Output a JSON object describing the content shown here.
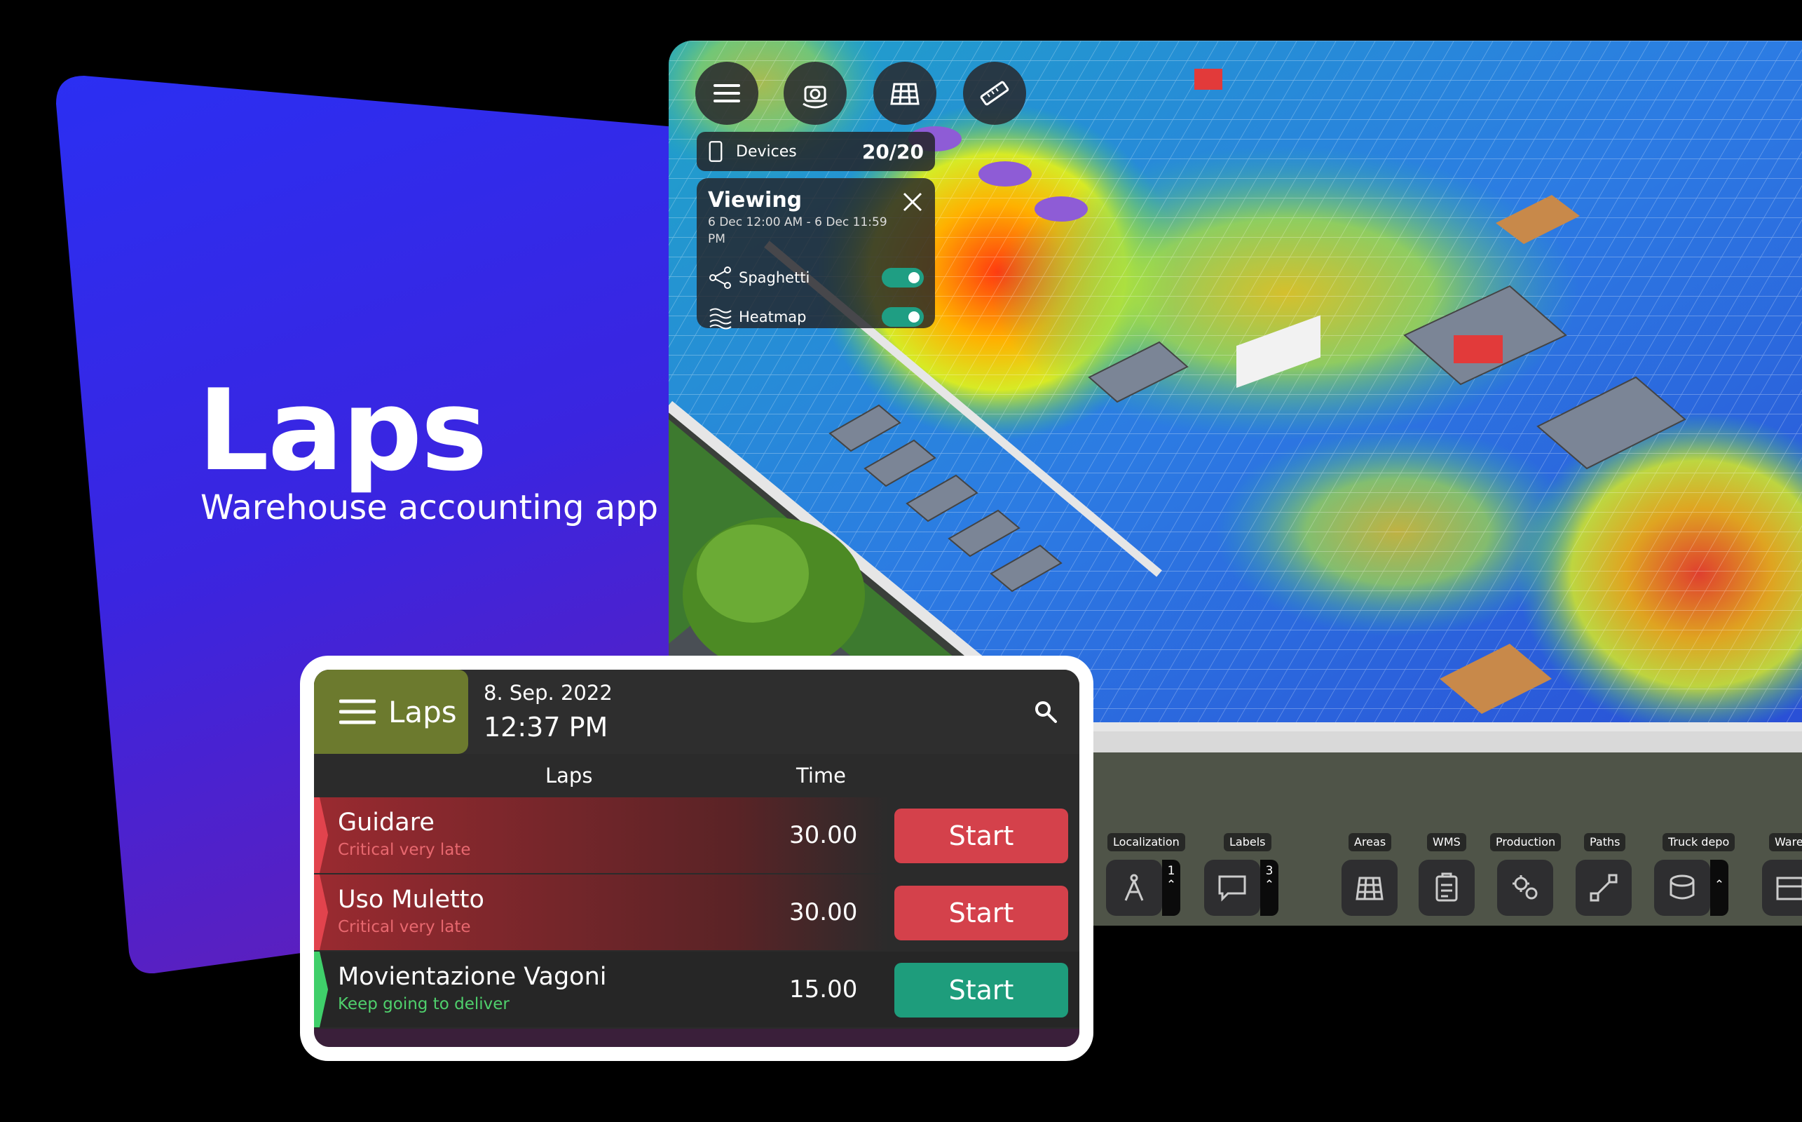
{
  "hero": {
    "title": "Laps",
    "subtitle": "Warehouse accounting app"
  },
  "map": {
    "top_buttons": [
      {
        "icon": "menu-icon"
      },
      {
        "icon": "camera-rotate-icon"
      },
      {
        "icon": "grid-icon"
      },
      {
        "icon": "ruler-icon"
      }
    ],
    "devices": {
      "label": "Devices",
      "value": "20/20"
    },
    "viewing": {
      "title": "Viewing",
      "range": "6 Dec 12:00 AM - 6 Dec 11:59 PM",
      "spaghetti_label": "Spaghetti",
      "spaghetti_on": true,
      "heatmap_label": "Heatmap",
      "heatmap_on": true
    },
    "toolbar": {
      "localization_label": "Localization",
      "localization_count": "1",
      "labels_label": "Labels",
      "labels_count": "3",
      "areas_label": "Areas",
      "wms_label": "WMS",
      "production_label": "Production",
      "paths_label": "Paths",
      "truck_label": "Truck depo",
      "ware_label": "Warel"
    }
  },
  "laps_app": {
    "brand": "Laps",
    "date": "8. Sep. 2022",
    "time": "12:37 PM",
    "col_laps": "Laps",
    "col_time": "Time",
    "rows": [
      {
        "name": "Guidare",
        "status": "Critical very late",
        "time": "30.00",
        "button": "Start",
        "state": "critical"
      },
      {
        "name": "Uso Muletto",
        "status": "Critical very late",
        "time": "30.00",
        "button": "Start",
        "state": "critical"
      },
      {
        "name": "Movientazione Vagoni",
        "status": "Keep going to deliver",
        "time": "15.00",
        "button": "Start",
        "state": "ok"
      }
    ]
  },
  "colors": {
    "hero_gradient_top": "#2b2ff2",
    "hero_gradient_bottom": "#5a1fc0",
    "brand_olive": "#6c7a2e",
    "critical_red": "#d4414b",
    "ok_green": "#1e9d7c",
    "toggle_teal": "#1f9e83"
  }
}
